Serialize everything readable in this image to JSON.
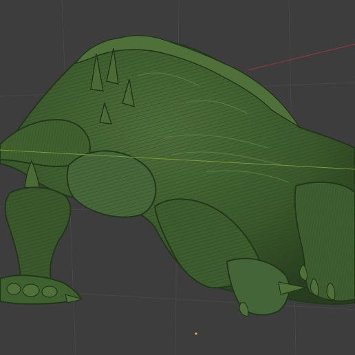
{
  "viewport": {
    "background": "#3d3d3d",
    "grid_color": "#474747"
  },
  "axes": {
    "x_axis_color": "#8a3a3a",
    "y_axis_color": "#7c9a3a"
  },
  "model": {
    "base_color": "#3b5a2c",
    "shade_color": "#22371a",
    "highlight_color": "#5c7e46"
  },
  "cursor_3d": {
    "color": "#e0b040"
  }
}
